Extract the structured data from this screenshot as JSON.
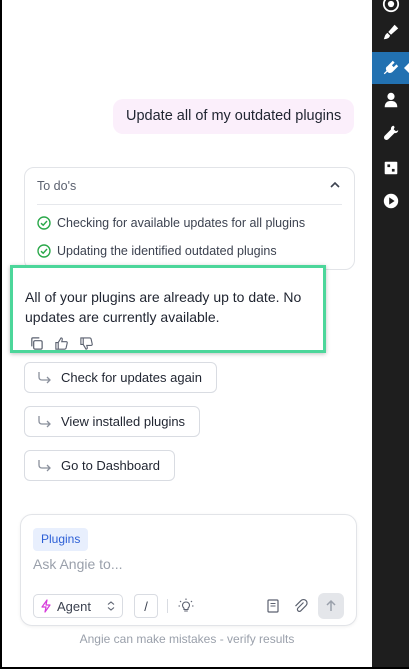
{
  "sidebar": {
    "icons": [
      "wordpress-icon",
      "paintbrush-icon",
      "plugin-icon",
      "users-icon",
      "tools-icon",
      "settings-icon",
      "play-icon"
    ]
  },
  "chat": {
    "user_message": "Update all of my outdated plugins",
    "todo": {
      "title": "To do's",
      "items": [
        "Checking for available updates for all plugins",
        "Updating the identified outdated plugins"
      ]
    },
    "answer": "All of your plugins are already up to date. No updates are currently available.",
    "suggestions": [
      "Check for updates again",
      "View installed plugins",
      "Go to Dashboard"
    ]
  },
  "composer": {
    "context_chip": "Plugins",
    "placeholder": "Ask Angie to...",
    "agent_label": "Agent",
    "slash_label": "/"
  },
  "footer": {
    "disclaimer": "Angie can make mistakes - verify results"
  },
  "colors": {
    "highlight_border": "#4cd69a",
    "accent": "#2271b1",
    "user_bubble": "#fbeffb",
    "chip_bg": "#e8effd",
    "agent_icon": "#d63adb"
  }
}
